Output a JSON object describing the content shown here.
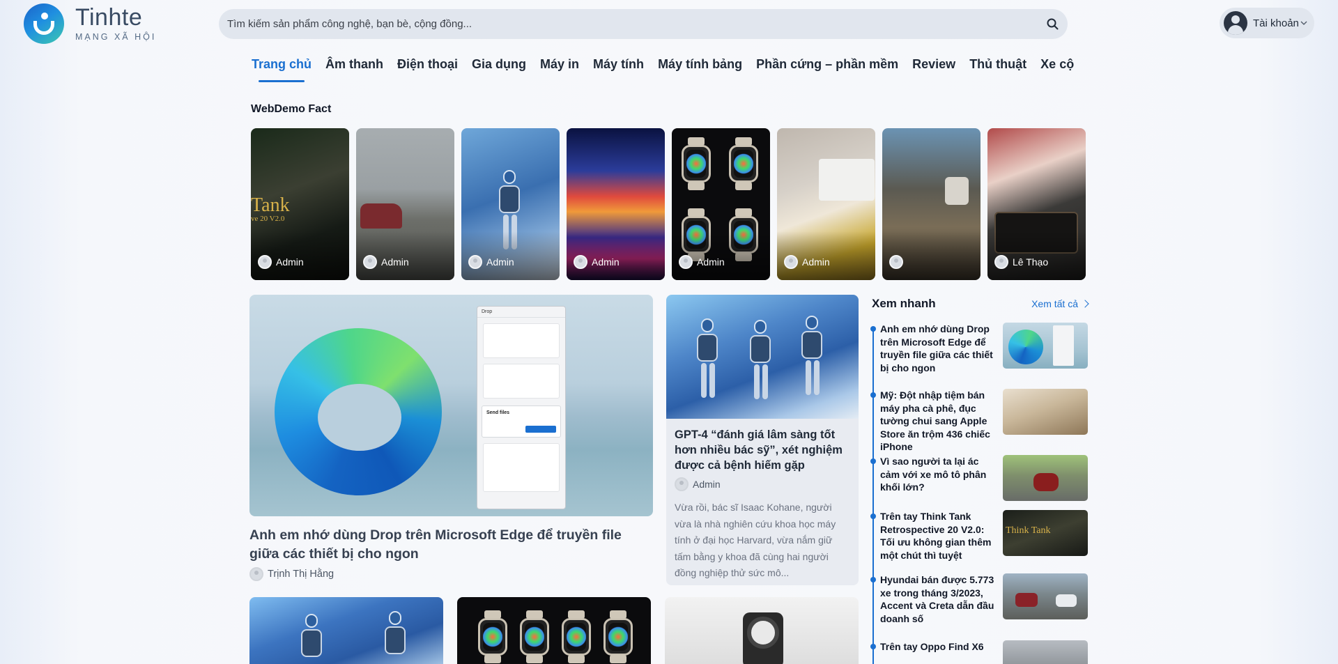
{
  "brand": {
    "name": "Tinhte",
    "tagline": "MẠNG XÃ HỘI"
  },
  "search": {
    "placeholder": "Tìm kiếm sản phẩm công nghệ, bạn bè, cộng đồng..."
  },
  "account": {
    "label": "Tài khoản"
  },
  "nav": [
    {
      "label": "Trang chủ",
      "active": true
    },
    {
      "label": "Âm thanh"
    },
    {
      "label": "Điện thoại"
    },
    {
      "label": "Gia dụng"
    },
    {
      "label": "Máy in"
    },
    {
      "label": "Máy tính"
    },
    {
      "label": "Máy tính bảng"
    },
    {
      "label": "Phần cứng – phần mềm"
    },
    {
      "label": "Review"
    },
    {
      "label": "Thủ thuật"
    },
    {
      "label": "Xe cộ"
    }
  ],
  "fact": {
    "title": "WebDemo Fact",
    "cards": [
      {
        "author": "Admin",
        "overlay_text": "Tank",
        "overlay_sub": "ve 20 V2.0"
      },
      {
        "author": "Admin"
      },
      {
        "author": "Admin"
      },
      {
        "author": "Admin"
      },
      {
        "author": "Admin"
      },
      {
        "author": "Admin"
      },
      {
        "author": ""
      },
      {
        "author": "Lê Thạo"
      }
    ]
  },
  "featured": {
    "title": "Anh em nhớ dùng Drop trên Microsoft Edge để truyền file giữa các thiết bị cho ngon",
    "author": "Trịnh Thị Hằng",
    "image_texts": {
      "window_title": "Drop",
      "dialog_title": "Send files",
      "dialog_button": "Send"
    }
  },
  "middle": {
    "title": "GPT-4 “đánh giá lâm sàng tốt hơn nhiều bác sỹ”, xét nghiệm được cả bệnh hiếm gặp",
    "author": "Admin",
    "excerpt": "Vừa rồi, bác sĩ Isaac Kohane, người vừa là nhà nghiên cứu khoa học máy tính ở đại học Harvard, vừa nắm giữ tấm bằng y khoa đã cùng hai người đồng nghiệp thử sức mô..."
  },
  "quick": {
    "title": "Xem nhanh",
    "see_all": "Xem tất cả",
    "items": [
      {
        "title": "Anh em nhớ dùng Drop trên Microsoft Edge để truyền file giữa các thiết bị cho ngon"
      },
      {
        "title": "Mỹ: Đột nhập tiệm bán máy pha cà phê, đục tường chui sang Apple Store ăn trộm 436 chiếc iPhone"
      },
      {
        "title": "Vì sao người ta lại ác cảm với xe mô tô phân khối lớn?"
      },
      {
        "title": "Trên tay Think Tank Retrospective 20 V2.0: Tối ưu không gian thêm một chút thì tuyệt",
        "thumb_text": "Think Tank"
      },
      {
        "title": "Hyundai bán được 5.773 xe trong tháng 3/2023, Accent và Creta dẫn đầu doanh số"
      },
      {
        "title": "Trên tay Oppo Find X6"
      }
    ]
  },
  "colors": {
    "accent": "#1a6fd0",
    "text": "#1f2937",
    "search_bg": "#e1e6ee"
  }
}
